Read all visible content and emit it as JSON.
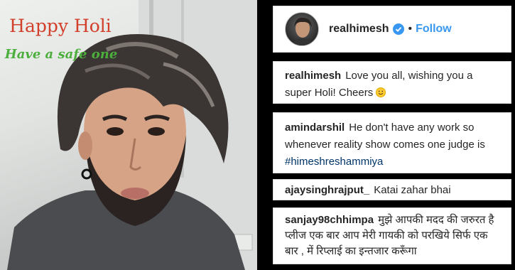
{
  "greeting": {
    "title": "Happy Holi",
    "subtitle": "Have a safe one"
  },
  "post": {
    "username": "realhimesh",
    "separator": "•",
    "follow_label": "Follow",
    "caption_text": "Love you all, wishing you a super Holi! Cheers"
  },
  "comments": [
    {
      "username": "amindarshil",
      "text": "He don't have any work so whenever reality show comes one judge is",
      "hashtag": "#himeshreshammiya"
    },
    {
      "username": "ajaysinghrajput_",
      "text": "Katai zahar bhai"
    },
    {
      "username": "sanjay98chhimpa",
      "text": "मुझे आपकी मदद की जरुरत है प्लीज एक बार आप मेरी गायकी को परखिये सिर्फ एक बार , में रिप्लाई का इन्तजार करूँगा"
    }
  ],
  "colors": {
    "greeting_title": "#d2402c",
    "greeting_subtitle": "#4caf3d",
    "follow": "#3897f0",
    "verified": "#3897f0",
    "hashtag": "#003569"
  },
  "icons": {
    "verified": "verified-badge-icon",
    "emoji": "smiling-face-icon"
  }
}
